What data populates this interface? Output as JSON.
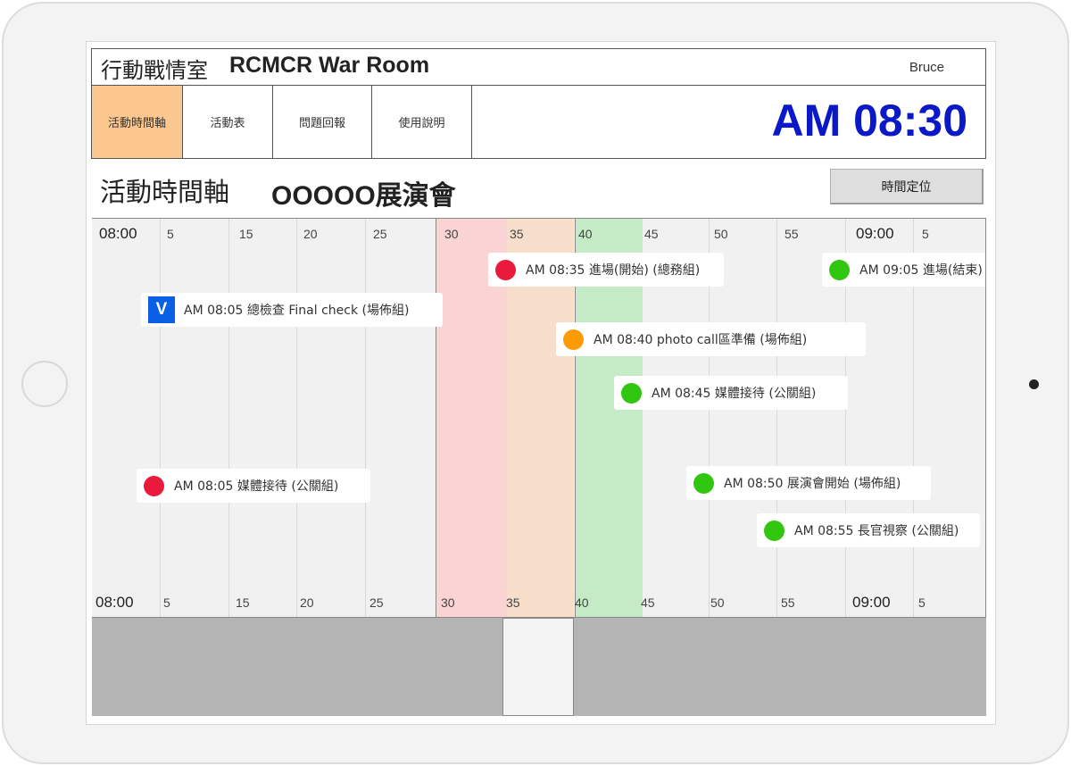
{
  "header": {
    "title_cn": "行動戰情室",
    "title_en": "RCMCR War Room",
    "user": "Bruce"
  },
  "nav": {
    "tabs": [
      {
        "label": "活動時間軸",
        "active": true
      },
      {
        "label": "活動表",
        "active": false
      },
      {
        "label": "問題回報",
        "active": false
      },
      {
        "label": "使用說明",
        "active": false
      }
    ],
    "clock": "AM 08:30"
  },
  "page": {
    "title": "活動時間軸",
    "event_name": "OOOOO展演會",
    "locate_button": "時間定位"
  },
  "timeline": {
    "ticks": [
      "08:00",
      "5",
      "15",
      "20",
      "25",
      "30",
      "35",
      "40",
      "45",
      "50",
      "55",
      "09:00",
      "5"
    ],
    "events": [
      {
        "text": "AM 08:35 進場(開始) (總務組)",
        "status": "red",
        "icon": "red-dot-icon"
      },
      {
        "text": "AM 09:05 進場(結束)",
        "status": "green",
        "icon": "green-dot-icon"
      },
      {
        "badge": "V",
        "text": "AM 08:05 總檢查 Final check (場佈組)",
        "status": "done",
        "icon": "check-badge-icon"
      },
      {
        "text": "AM 08:40 photo call區準備 (場佈組)",
        "status": "orange",
        "icon": "orange-dot-icon"
      },
      {
        "text": "AM 08:45 媒體接待 (公關組)",
        "status": "green",
        "icon": "green-dot-icon"
      },
      {
        "text": "AM 08:05 媒體接待 (公關組)",
        "status": "red",
        "icon": "red-dot-icon"
      },
      {
        "text": "AM 08:50 展演會開始 (場佈組)",
        "status": "green",
        "icon": "green-dot-icon"
      },
      {
        "text": "AM 08:55 長官視察 (公關組)",
        "status": "green",
        "icon": "green-dot-icon"
      }
    ]
  },
  "colors": {
    "clock": "#0a18c8",
    "active_tab": "#fcc78f",
    "band_red": "#fad4d4",
    "band_orange": "#f7decb",
    "band_green": "#c4ebc6",
    "status_red": "#ea1a3c",
    "status_orange": "#fd9b06",
    "status_green": "#31c610",
    "badge_blue": "#0a60e4"
  }
}
